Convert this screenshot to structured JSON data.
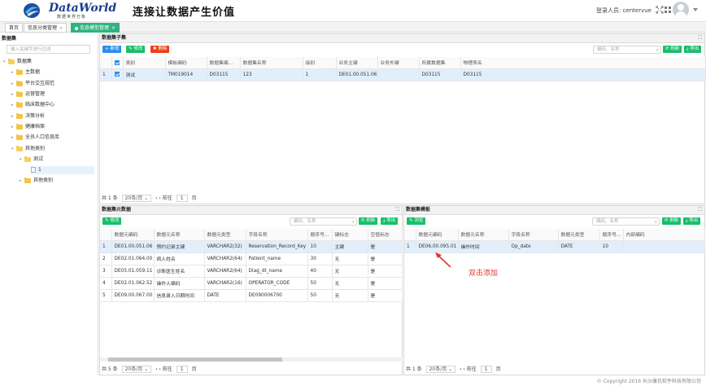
{
  "header": {
    "logo_title": "DataWorld",
    "logo_sub": "数据世界万象",
    "slogan": "连接让数据产生价值",
    "login_label": "登录人员: centervue",
    "icons": [
      "fullscreen-icon",
      "menu-grid-icon",
      "user-avatar-icon"
    ]
  },
  "tabs": [
    {
      "label": "首页"
    },
    {
      "label": "信息分类管理"
    },
    {
      "label": "信息模型管理"
    }
  ],
  "tree": {
    "title": "数据集",
    "search_placeholder": "输入关键字进行过滤",
    "nodes": [
      {
        "label": "数据集"
      },
      {
        "label": "主数据"
      },
      {
        "label": "平台交互规范"
      },
      {
        "label": "运营管理"
      },
      {
        "label": "临床数据中心"
      },
      {
        "label": "决策分析"
      },
      {
        "label": "健康档案"
      },
      {
        "label": "全员人口信息库"
      },
      {
        "label": "其他类别"
      },
      {
        "label": "测试"
      },
      {
        "label": "1"
      },
      {
        "label": "其他类别"
      }
    ]
  },
  "subset": {
    "title": "数据集子集",
    "btn_add": "+ 新增",
    "btn_edit": "✎ 修改",
    "btn_delete": "✖ 删除",
    "search_placeholder": "编码、名称",
    "btn_refresh": "⟳ 刷新",
    "btn_export": "⤓ 导出",
    "columns": [
      "类别",
      "模板编码",
      "数据集编...",
      "数据集名称",
      "级别",
      "业务主键",
      "业务外键",
      "所属数据集",
      "物理表名"
    ],
    "rows": [
      {
        "index": "1",
        "cells": [
          "测试",
          "TM019014",
          "D03115",
          "123",
          "1",
          "DE01.00.051.06",
          "",
          "D03115",
          "D03115"
        ]
      }
    ],
    "pager": {
      "total": "共 1 条",
      "page_size": "20条/页",
      "goto": "前往",
      "page": "1",
      "page_unit": "页"
    }
  },
  "elements": {
    "title": "数据集元数据",
    "btn_edit": "✎ 修改",
    "search_placeholder": "编码、名称",
    "btn_refresh": "⟳ 刷新",
    "btn_export": "⤓ 导出",
    "columns": [
      "数据元编码",
      "数据元名称",
      "数据元类型",
      "字段名称",
      "顺序号...",
      "键标志",
      "空值标志"
    ],
    "rows": [
      {
        "index": "1",
        "cells": [
          "DE01.00.051.06",
          "预约记录主键",
          "VARCHAR2(32)",
          "Reservation_Record_Key",
          "10",
          "主键",
          "是"
        ]
      },
      {
        "index": "2",
        "cells": [
          "DE02.01.064.00",
          "病人姓名",
          "VARCHAR2(64)",
          "Patient_name",
          "30",
          "无",
          "是"
        ]
      },
      {
        "index": "3",
        "cells": [
          "DE05.01.059.11",
          "诊断医生姓名",
          "VARCHAR2(64)",
          "Diag_dt_name",
          "40",
          "无",
          "是"
        ]
      },
      {
        "index": "4",
        "cells": [
          "DE02.01.062.52",
          "操作人编码",
          "VARCHAR2(16)",
          "OPERATOR_CODE",
          "50",
          "无",
          "是"
        ]
      },
      {
        "index": "5",
        "cells": [
          "DE09.00.067.00",
          "信息录入日期时间",
          "DATE",
          "DE090006700",
          "50",
          "无",
          "是"
        ]
      }
    ],
    "pager": {
      "total": "共 5 条",
      "page_size": "20条/页",
      "goto": "前往",
      "page": "1",
      "page_unit": "页"
    }
  },
  "template": {
    "title": "数据集模板",
    "btn_browse": "✎ 浏览",
    "search_placeholder": "编码、名称",
    "btn_refresh": "⟳ 刷新",
    "btn_export": "⤓ 导出",
    "columns": [
      "数据元编码",
      "数据元名称",
      "字段名称",
      "数据元类型",
      "顺序号...",
      "内部编码"
    ],
    "rows": [
      {
        "index": "1",
        "cells": [
          "DE06.00.095.01",
          "操作时间",
          "Op_date",
          "DATE",
          "10",
          ""
        ]
      }
    ],
    "pager": {
      "total": "共 1 条",
      "page_size": "20条/页",
      "goto": "前往",
      "page": "1",
      "page_unit": "页"
    }
  },
  "annotation": "双击添加",
  "footer": "© Copyright 2016 长沙康氏软件科技有限公司",
  "colors": {
    "accent_green": "#2fb380",
    "primary_blue": "#2d8cf0",
    "danger_red": "#ed4014",
    "annotation_red": "#e5332a",
    "selected_row": "#e1effc"
  }
}
